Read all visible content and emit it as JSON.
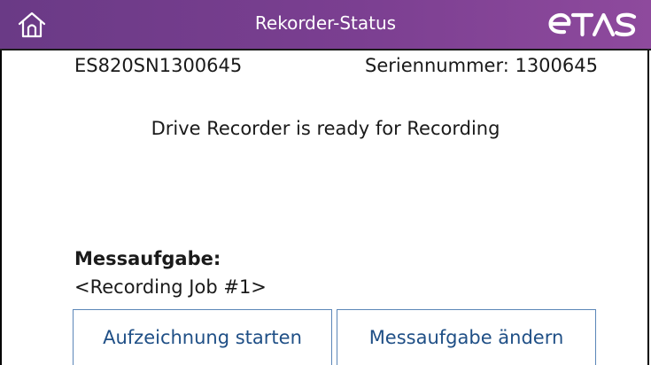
{
  "header": {
    "title": "Rekorder-Status",
    "logo_text": "ETAS",
    "home_icon": "home-icon",
    "colors": {
      "bar_start": "#6a3a86",
      "bar_end": "#8e4a9d",
      "text": "#ffffff"
    }
  },
  "device": {
    "name": "ES820SN1300645",
    "serial": "Seriennummer: 1300645"
  },
  "status": {
    "message": "Drive Recorder is ready for Recording"
  },
  "task": {
    "label": "Messaufgabe:",
    "value": "<Recording Job #1>"
  },
  "buttons": {
    "start_label": "Aufzeichnung starten",
    "change_label": "Messaufgabe ändern",
    "color": "#1f4f86"
  }
}
